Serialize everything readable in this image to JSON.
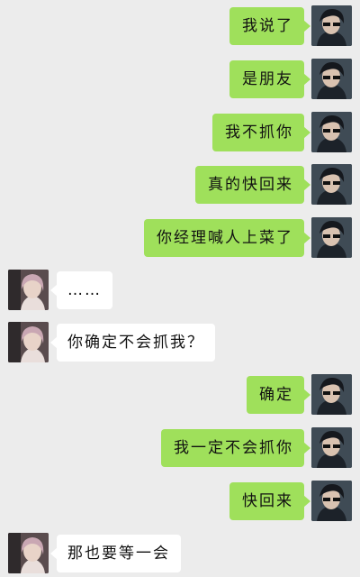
{
  "messages": [
    {
      "side": "me",
      "text": "我说了"
    },
    {
      "side": "me",
      "text": "是朋友"
    },
    {
      "side": "me",
      "text": "我不抓你"
    },
    {
      "side": "me",
      "text": "真的快回来"
    },
    {
      "side": "me",
      "text": "你经理喊人上菜了"
    },
    {
      "side": "other",
      "text": "……"
    },
    {
      "side": "other",
      "text": "你确定不会抓我？"
    },
    {
      "side": "me",
      "text": "确定"
    },
    {
      "side": "me",
      "text": "我一定不会抓你"
    },
    {
      "side": "me",
      "text": "快回来"
    },
    {
      "side": "other",
      "text": "那也要等一会"
    }
  ],
  "colors": {
    "background": "#ececec",
    "sent_bubble": "#9fe05b",
    "received_bubble": "#ffffff"
  }
}
